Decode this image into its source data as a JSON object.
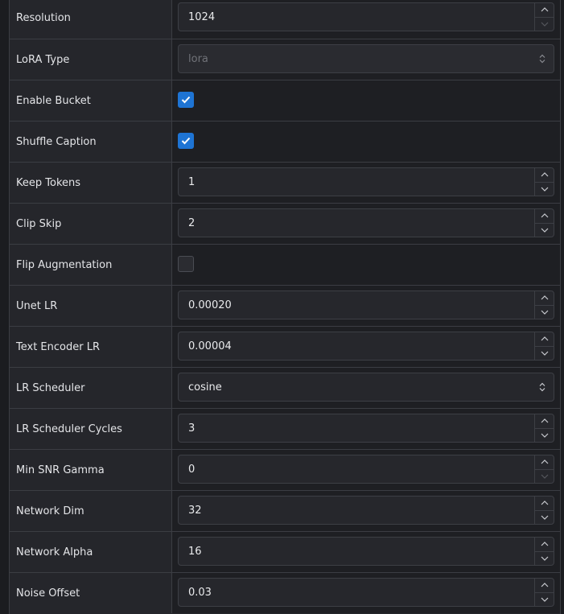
{
  "rows": [
    {
      "label": "Resolution",
      "kind": "number",
      "value": "1024",
      "up_disabled": false,
      "down_disabled": true
    },
    {
      "label": "LoRA Type",
      "kind": "select",
      "value": "lora",
      "disabled": true
    },
    {
      "label": "Enable Bucket",
      "kind": "checkbox",
      "checked": true
    },
    {
      "label": "Shuffle Caption",
      "kind": "checkbox",
      "checked": true
    },
    {
      "label": "Keep Tokens",
      "kind": "number",
      "value": "1"
    },
    {
      "label": "Clip Skip",
      "kind": "number",
      "value": "2"
    },
    {
      "label": "Flip Augmentation",
      "kind": "checkbox",
      "checked": false
    },
    {
      "label": "Unet LR",
      "kind": "number",
      "value": "0.00020"
    },
    {
      "label": "Text Encoder LR",
      "kind": "number",
      "value": "0.00004"
    },
    {
      "label": "LR Scheduler",
      "kind": "select",
      "value": "cosine",
      "disabled": false
    },
    {
      "label": "LR Scheduler Cycles",
      "kind": "number",
      "value": "3"
    },
    {
      "label": "Min SNR Gamma",
      "kind": "number",
      "value": "0",
      "down_disabled": true
    },
    {
      "label": "Network Dim",
      "kind": "number",
      "value": "32"
    },
    {
      "label": "Network Alpha",
      "kind": "number",
      "value": "16"
    },
    {
      "label": "Noise Offset",
      "kind": "number",
      "value": "0.03"
    }
  ],
  "colors": {
    "accent": "#1e74d4",
    "label_text": "#e4e5e8",
    "border": "#3b3d43"
  },
  "icons": {
    "spin_up": "chevron-up-icon",
    "spin_down": "chevron-down-icon",
    "select": "chevron-up-down-icon",
    "check": "check-icon"
  }
}
